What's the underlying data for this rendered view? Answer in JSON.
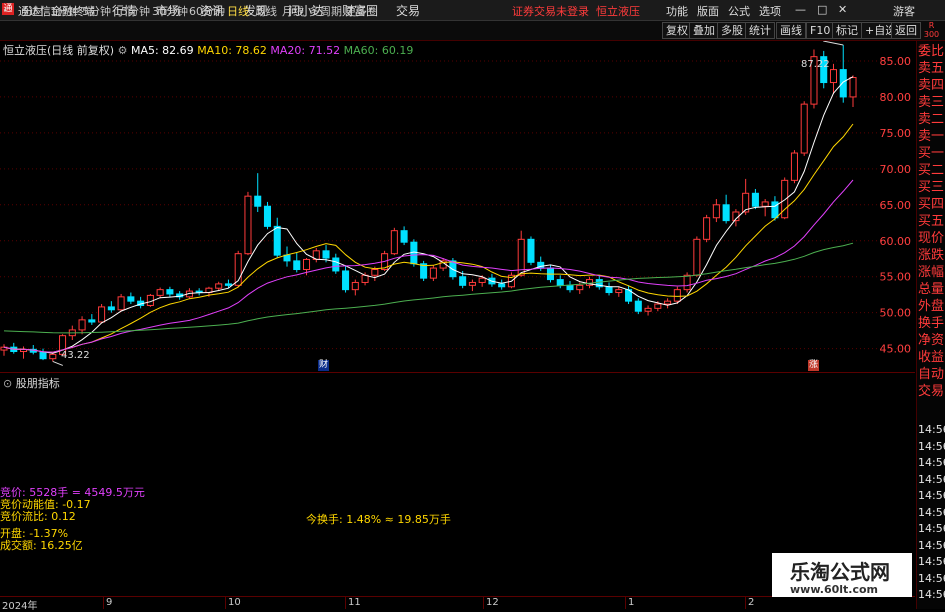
{
  "app": {
    "title": "通达信金融终端",
    "notice": "证券交易未登录",
    "stock_name_top": "恒立液压",
    "user": "游客"
  },
  "menu": [
    "行情",
    "市场",
    "资讯",
    "发现",
    "问小达",
    "财富圈",
    "交易"
  ],
  "top_right": [
    "功能",
    "版面",
    "公式",
    "选项"
  ],
  "toolbar": {
    "periods": [
      "分时",
      "1分钟",
      "5分钟",
      "15分钟",
      "30分钟",
      "60分钟",
      "日线",
      "周线",
      "月线",
      "多周期",
      "更多"
    ],
    "active": "日线",
    "right_buttons": [
      "复权",
      "叠加",
      "多股",
      "统计",
      "画线",
      "F10",
      "标记",
      "+自选",
      "返回"
    ]
  },
  "header": {
    "stock_label": "恒立液压(日线 前复权)",
    "ma": [
      {
        "label": "MA5: 82.69",
        "color": "#ffffff"
      },
      {
        "label": "MA10: 78.62",
        "color": "#ffd700"
      },
      {
        "label": "MA20: 71.52",
        "color": "#e040fb"
      },
      {
        "label": "MA60: 60.19",
        "color": "#4caf50"
      }
    ]
  },
  "annotations": {
    "high": "87.22",
    "low": "43.22",
    "marker_cai": "财",
    "marker_zhang": "涨"
  },
  "sub_chart": {
    "title": "股朋指标"
  },
  "info": {
    "bid_price": "竞价: 5528手 = 4549.5万元",
    "bid_energy": "竞价动能值: -0.17",
    "bid_ratio": "竞价流比: 0.12",
    "open": "开盘: -1.37%",
    "amount": "成交额: 16.25亿",
    "turnover": "今换手: 1.48% ≈ 19.85万手"
  },
  "right_panel": [
    "委比",
    "卖五",
    "卖四",
    "卖三",
    "卖二",
    "卖一",
    "买一",
    "买二",
    "买三",
    "买四",
    "买五",
    "现价",
    "涨跌",
    "涨幅",
    "总量",
    "外盘",
    "换手",
    "净资",
    "收益",
    "自动",
    "交易",
    "14:56",
    "14:56",
    "14:56",
    "14:56",
    "14:56",
    "14:56",
    "14:56",
    "14:56",
    "14:56",
    "14:56",
    "14:56"
  ],
  "x_axis": {
    "labels": [
      "2024年",
      "9",
      "10",
      "11",
      "12",
      "1",
      "2"
    ]
  },
  "watermark": {
    "main": "乐淘公式网",
    "url": "www.60lt.com"
  },
  "chart_data": {
    "type": "candlestick",
    "y_ticks": [
      45.0,
      50.0,
      55.0,
      60.0,
      65.0,
      70.0,
      75.0,
      80.0,
      85.0
    ],
    "ylim": [
      43.0,
      87.5
    ],
    "candles": [
      [
        44.8,
        45.6,
        44.0,
        45.2
      ],
      [
        45.2,
        45.8,
        44.3,
        44.6
      ],
      [
        44.6,
        45.3,
        43.6,
        44.9
      ],
      [
        44.9,
        45.5,
        44.2,
        44.5
      ],
      [
        44.5,
        45.0,
        43.4,
        43.6
      ],
      [
        43.6,
        44.4,
        43.22,
        44.2
      ],
      [
        44.2,
        47.0,
        44.0,
        46.8
      ],
      [
        46.8,
        48.2,
        46.2,
        47.6
      ],
      [
        47.6,
        49.5,
        47.0,
        49.0
      ],
      [
        49.0,
        49.8,
        48.3,
        48.7
      ],
      [
        48.7,
        51.2,
        48.5,
        50.8
      ],
      [
        50.8,
        51.6,
        50.0,
        50.4
      ],
      [
        50.4,
        52.6,
        50.2,
        52.2
      ],
      [
        52.2,
        52.8,
        51.2,
        51.6
      ],
      [
        51.6,
        52.2,
        50.6,
        51.0
      ],
      [
        51.0,
        52.6,
        50.8,
        52.4
      ],
      [
        52.4,
        53.5,
        52.0,
        53.2
      ],
      [
        53.2,
        53.6,
        52.2,
        52.6
      ],
      [
        52.6,
        53.0,
        51.8,
        52.2
      ],
      [
        52.2,
        53.4,
        52.0,
        53.0
      ],
      [
        53.0,
        53.4,
        52.4,
        52.8
      ],
      [
        52.8,
        53.6,
        52.2,
        53.4
      ],
      [
        53.4,
        54.3,
        53.0,
        54.0
      ],
      [
        54.0,
        54.6,
        53.4,
        53.8
      ],
      [
        53.8,
        58.6,
        53.6,
        58.2
      ],
      [
        58.2,
        66.8,
        58.0,
        66.2
      ],
      [
        66.2,
        69.4,
        64.0,
        64.8
      ],
      [
        64.8,
        65.4,
        61.6,
        62.0
      ],
      [
        62.0,
        63.2,
        57.6,
        58.0
      ],
      [
        58.0,
        59.2,
        56.4,
        57.2
      ],
      [
        57.2,
        58.4,
        55.6,
        56.0
      ],
      [
        56.0,
        57.6,
        55.2,
        57.4
      ],
      [
        57.4,
        59.0,
        57.0,
        58.6
      ],
      [
        58.6,
        59.4,
        57.0,
        57.6
      ],
      [
        57.6,
        58.2,
        55.4,
        55.8
      ],
      [
        55.8,
        56.6,
        52.8,
        53.2
      ],
      [
        53.2,
        54.6,
        52.4,
        54.2
      ],
      [
        54.2,
        55.6,
        53.8,
        55.2
      ],
      [
        55.2,
        56.4,
        54.4,
        56.0
      ],
      [
        56.0,
        58.6,
        55.8,
        58.2
      ],
      [
        58.2,
        61.8,
        58.0,
        61.4
      ],
      [
        61.4,
        62.0,
        59.4,
        59.8
      ],
      [
        59.8,
        60.2,
        56.4,
        56.8
      ],
      [
        56.8,
        57.2,
        54.4,
        54.8
      ],
      [
        54.8,
        56.6,
        54.4,
        56.2
      ],
      [
        56.2,
        57.6,
        55.8,
        57.2
      ],
      [
        57.2,
        57.6,
        54.6,
        55.0
      ],
      [
        55.0,
        55.8,
        53.4,
        53.8
      ],
      [
        53.8,
        54.6,
        53.0,
        54.2
      ],
      [
        54.2,
        55.2,
        53.6,
        54.8
      ],
      [
        54.8,
        55.4,
        53.6,
        54.0
      ],
      [
        54.0,
        54.6,
        53.2,
        53.6
      ],
      [
        53.6,
        55.6,
        53.4,
        55.2
      ],
      [
        55.2,
        61.4,
        55.0,
        60.2
      ],
      [
        60.2,
        60.6,
        56.6,
        57.0
      ],
      [
        57.0,
        57.8,
        55.8,
        56.2
      ],
      [
        56.2,
        56.6,
        54.2,
        54.6
      ],
      [
        54.6,
        55.2,
        53.4,
        53.8
      ],
      [
        53.8,
        54.4,
        52.8,
        53.2
      ],
      [
        53.2,
        54.2,
        52.6,
        53.8
      ],
      [
        53.8,
        55.0,
        53.4,
        54.6
      ],
      [
        54.6,
        55.2,
        53.2,
        53.6
      ],
      [
        53.6,
        54.2,
        52.4,
        52.8
      ],
      [
        52.8,
        53.6,
        52.2,
        53.2
      ],
      [
        53.2,
        53.8,
        51.2,
        51.6
      ],
      [
        51.6,
        52.0,
        49.8,
        50.2
      ],
      [
        50.2,
        51.0,
        49.6,
        50.6
      ],
      [
        50.6,
        51.6,
        50.2,
        51.2
      ],
      [
        51.2,
        52.0,
        50.6,
        51.6
      ],
      [
        51.6,
        53.6,
        51.2,
        53.2
      ],
      [
        53.2,
        55.6,
        52.8,
        55.2
      ],
      [
        55.2,
        60.6,
        55.0,
        60.2
      ],
      [
        60.2,
        63.6,
        59.8,
        63.2
      ],
      [
        63.2,
        65.8,
        62.6,
        65.0
      ],
      [
        65.0,
        66.4,
        62.4,
        62.8
      ],
      [
        62.8,
        64.4,
        62.0,
        64.0
      ],
      [
        64.0,
        68.6,
        63.6,
        66.6
      ],
      [
        66.6,
        67.2,
        64.4,
        64.8
      ],
      [
        64.8,
        65.8,
        63.4,
        65.4
      ],
      [
        65.4,
        66.2,
        62.8,
        63.2
      ],
      [
        63.2,
        68.8,
        63.0,
        68.4
      ],
      [
        68.4,
        72.6,
        68.0,
        72.2
      ],
      [
        72.2,
        79.4,
        71.8,
        79.0
      ],
      [
        79.0,
        86.6,
        78.4,
        85.6
      ],
      [
        85.6,
        86.4,
        81.2,
        82.0
      ],
      [
        82.0,
        84.6,
        80.4,
        83.8
      ],
      [
        83.8,
        87.22,
        79.2,
        80.0
      ],
      [
        80.0,
        83.0,
        78.6,
        82.7
      ]
    ]
  }
}
